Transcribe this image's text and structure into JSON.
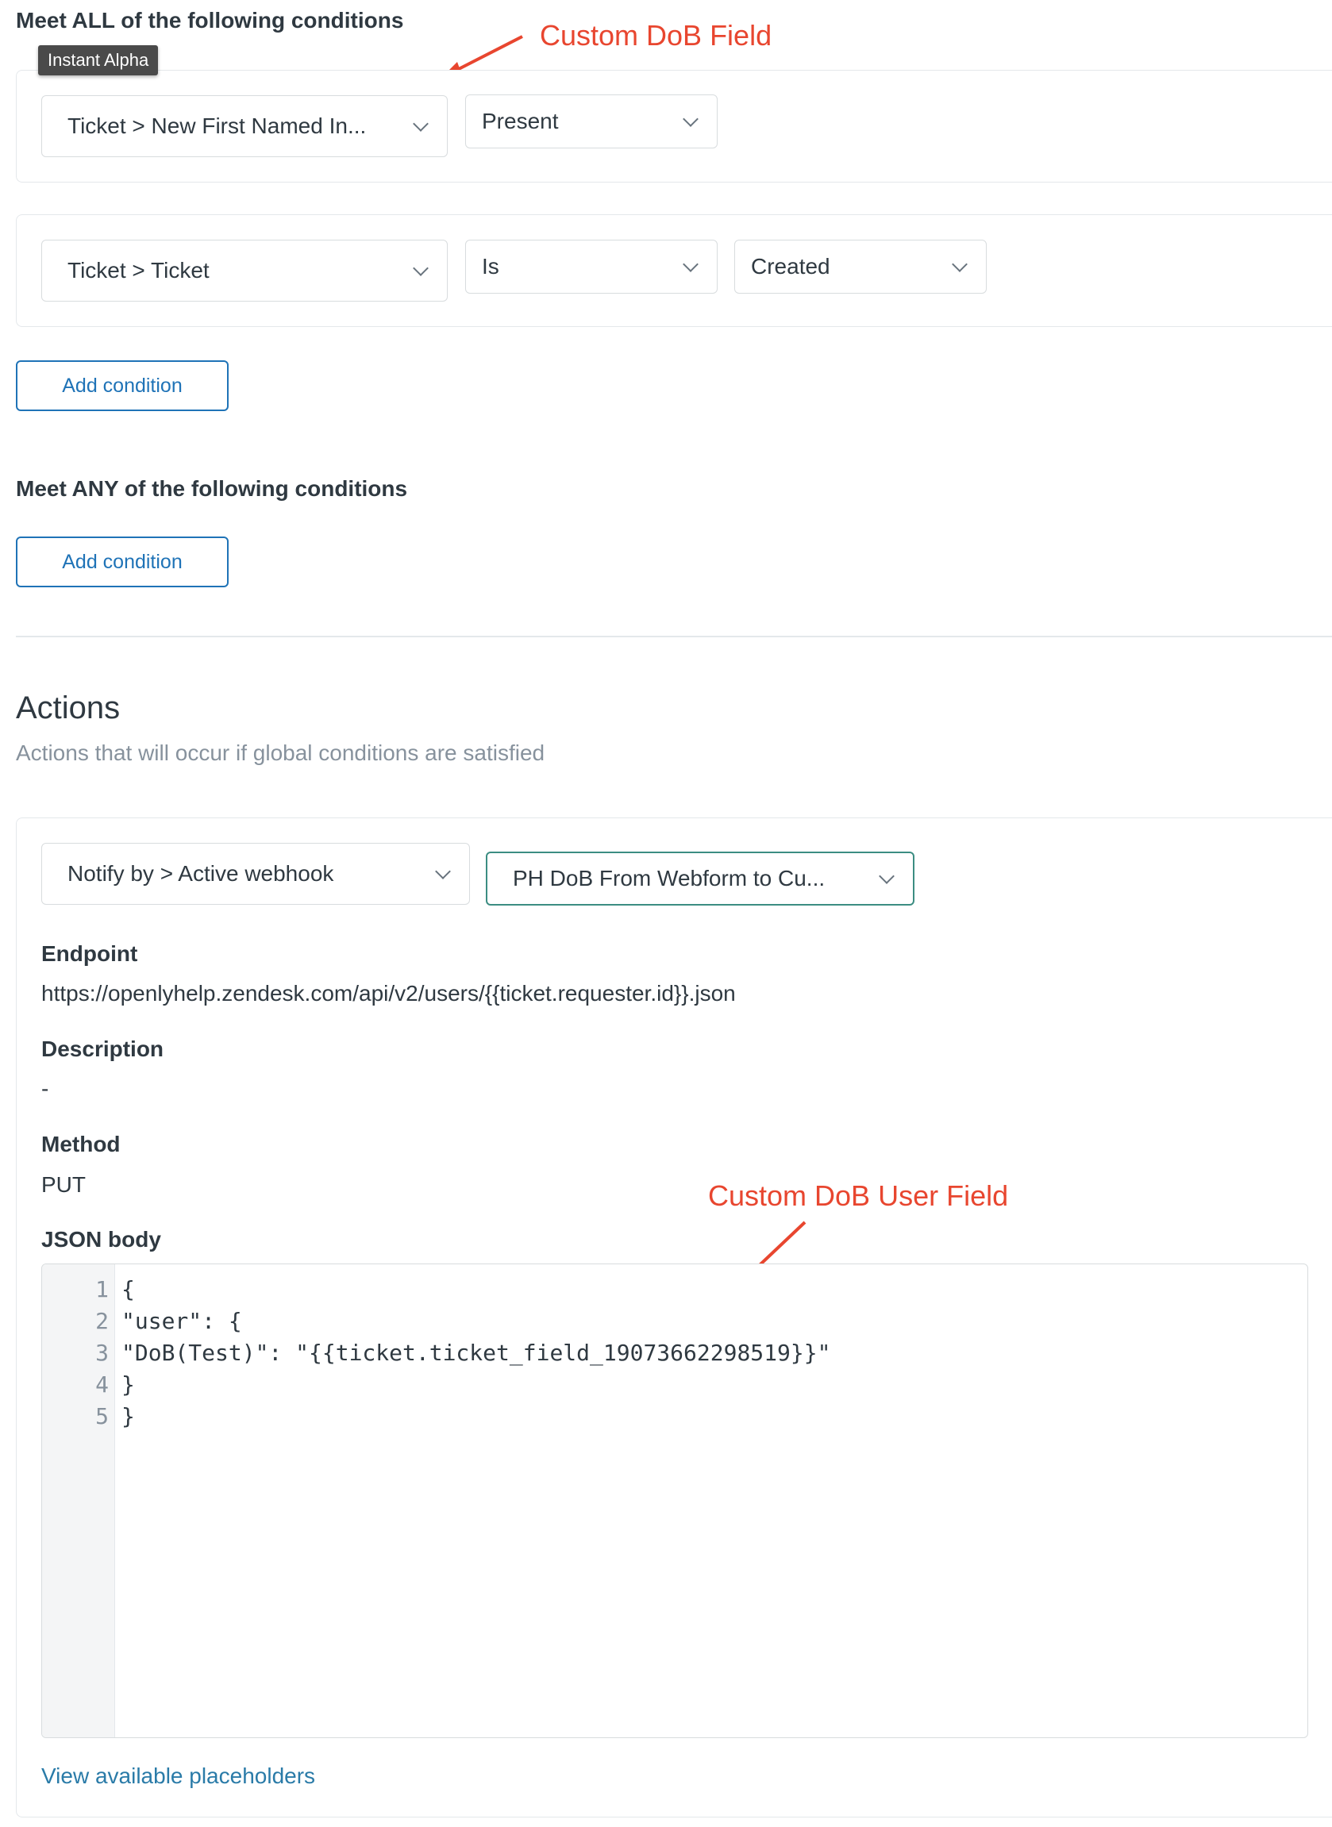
{
  "all_conditions": {
    "heading": "Meet ALL of the following conditions",
    "tooltip": "Instant Alpha",
    "rows": [
      {
        "field": "Ticket > New First Named In...",
        "operator": "Present"
      },
      {
        "field": "Ticket > Ticket",
        "operator": "Is",
        "value": "Created"
      }
    ],
    "add_button": "Add condition"
  },
  "any_conditions": {
    "heading": "Meet ANY of the following conditions",
    "add_button": "Add condition"
  },
  "annotations": {
    "top": "Custom DoB Field",
    "bottom": "Custom DoB User Field",
    "color": "#e8462f"
  },
  "actions": {
    "title": "Actions",
    "subtitle": "Actions that will occur if global conditions are satisfied",
    "action_select": "Notify by > Active webhook",
    "webhook_select": "PH DoB From Webform to Cu...",
    "endpoint_label": "Endpoint",
    "endpoint_value": "https://openlyhelp.zendesk.com/api/v2/users/{{ticket.requester.id}}.json",
    "description_label": "Description",
    "description_value": "-",
    "method_label": "Method",
    "method_value": "PUT",
    "json_label": "JSON body",
    "json_lines": [
      {
        "num": "1",
        "text": "{"
      },
      {
        "num": "2",
        "text": "\"user\": {"
      },
      {
        "num": "3",
        "text": "\"DoB(Test)\": \"{{ticket.ticket_field_19073662298519}}\""
      },
      {
        "num": "4",
        "text": "}"
      },
      {
        "num": "5",
        "text": "}"
      }
    ],
    "placeholders_link": "View available placeholders"
  }
}
